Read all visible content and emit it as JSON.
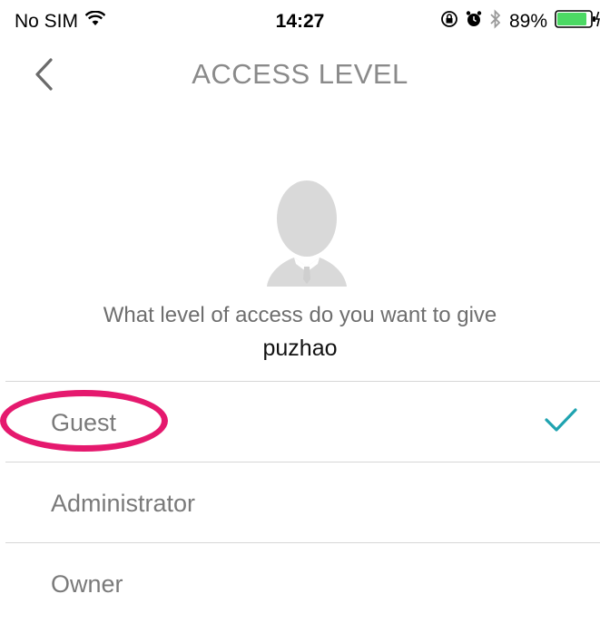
{
  "status_bar": {
    "carrier": "No SIM",
    "time": "14:27",
    "battery_percent": "89%",
    "battery_level": 0.89,
    "battery_color": "#4cd964"
  },
  "header": {
    "title": "ACCESS LEVEL"
  },
  "prompt": {
    "question": "What level of access do you want to give",
    "username": "puzhao"
  },
  "options": [
    {
      "label": "Guest",
      "selected": true
    },
    {
      "label": "Administrator",
      "selected": false
    },
    {
      "label": "Owner",
      "selected": false
    }
  ],
  "colors": {
    "accent": "#1fa3b0",
    "highlight": "#e5196e"
  }
}
